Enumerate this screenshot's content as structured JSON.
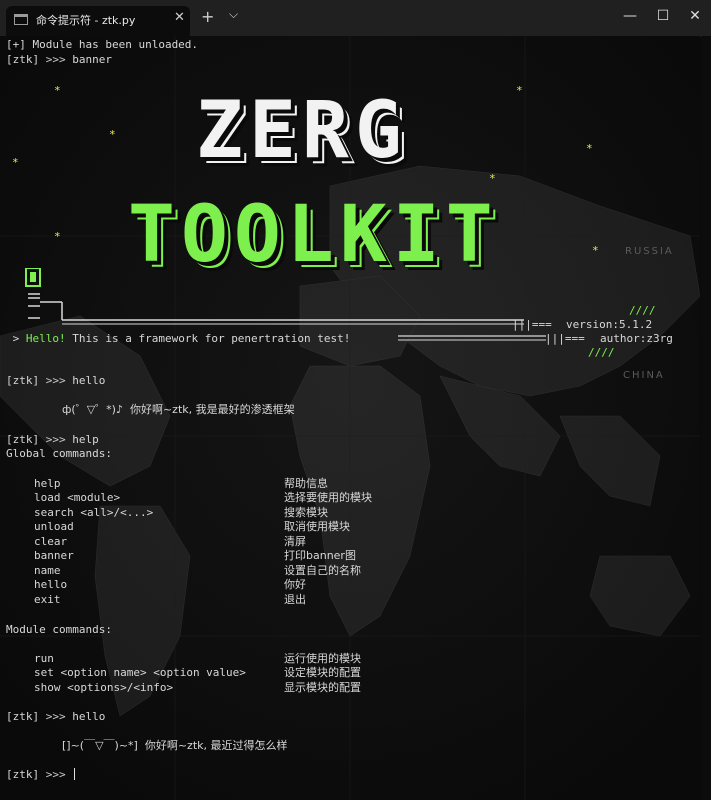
{
  "window": {
    "tab_title": "命令提示符 - ztk.py",
    "tab_close": "✕",
    "new_tab": "+",
    "dropdown": "⌵",
    "minimize": "—",
    "maximize": "☐",
    "close": "✕"
  },
  "banner": {
    "word1": "ZERG",
    "word2": "TOOLKIT",
    "hello_prefix": " > ",
    "hello_green": "Hello!",
    "hello_rest": " This is a framework for penertration test!",
    "version": "version:5.1.2",
    "author": "author:z3rg",
    "slashes_top": "////",
    "slashes_bottom": "////",
    "deco_left": "==\n==\n==",
    "deco_bar": "|||===",
    "stars": "*"
  },
  "terminal": {
    "line_unloaded": "[+] Module has been unloaded.",
    "prompt": "[ztk]",
    "arrows": ">>>",
    "cmd_banner": "banner",
    "cmd_hello_1": "hello",
    "hello_response_1": "ф(゜▽゜*)♪  你好啊~ztk, 我是最好的渗透框架",
    "cmd_help": "help",
    "global_header": "Global commands:",
    "global_commands": [
      {
        "name": "help",
        "desc": "帮助信息"
      },
      {
        "name": "load <module>",
        "desc": "选择要使用的模块"
      },
      {
        "name": "search <all>/<...>",
        "desc": "搜索模块"
      },
      {
        "name": "unload",
        "desc": "取消使用模块"
      },
      {
        "name": "clear",
        "desc": "清屏"
      },
      {
        "name": "banner",
        "desc": "打印banner图"
      },
      {
        "name": "name",
        "desc": "设置自己的名称"
      },
      {
        "name": "hello",
        "desc": "你好"
      },
      {
        "name": "exit",
        "desc": "退出"
      }
    ],
    "module_header": "Module commands:",
    "module_commands": [
      {
        "name": "run",
        "desc": "运行使用的模块"
      },
      {
        "name": "set <option name> <option value>",
        "desc": "设定模块的配置"
      },
      {
        "name": "show <options>/<info>",
        "desc": "显示模块的配置"
      }
    ],
    "cmd_hello_2": "hello",
    "hello_response_2": "[]~(￣▽￣)~*]  你好啊~ztk, 最近过得怎么样"
  },
  "map_labels": {
    "russia": "RUSSIA",
    "china": "CHINA"
  },
  "colors": {
    "background": "#0a0a0a",
    "accent_green": "#7ef04e",
    "star_yellow": "#e9e95a",
    "text": "#d8d8d8"
  }
}
